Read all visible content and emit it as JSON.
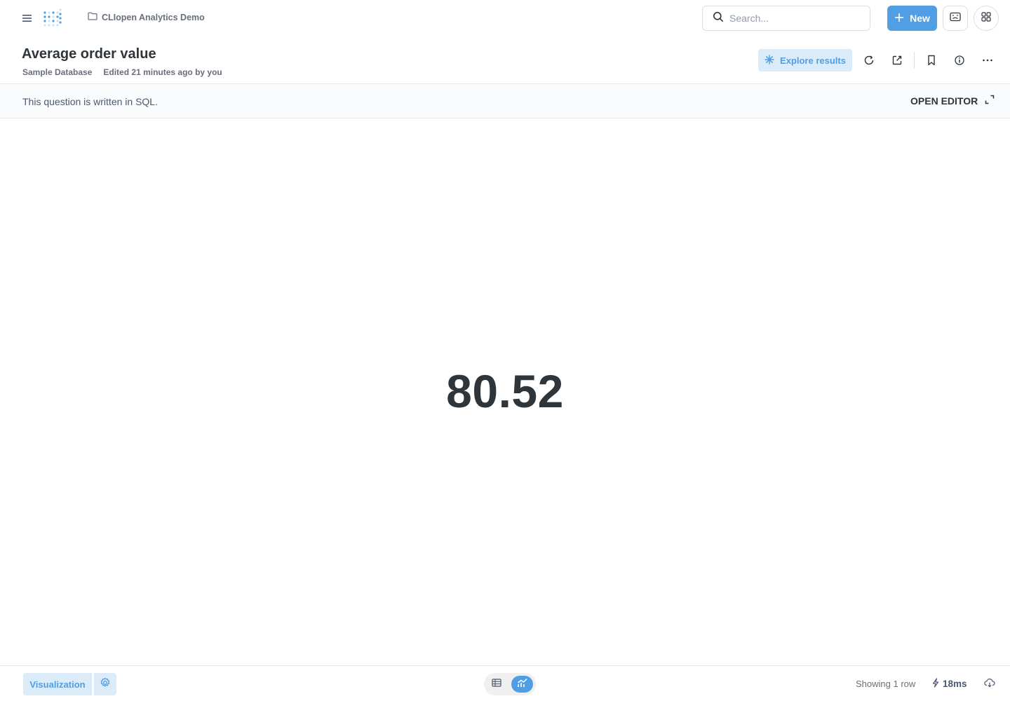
{
  "nav": {
    "breadcrumb_label": "CLIopen Analytics Demo",
    "search_placeholder": "Search...",
    "new_label": "New"
  },
  "question": {
    "title": "Average order value",
    "database": "Sample Database",
    "edited": "Edited 21 minutes ago by you",
    "explore_label": "Explore results"
  },
  "sql_banner": {
    "text": "This question is written in SQL.",
    "open_editor_label": "OPEN EDITOR"
  },
  "result": {
    "value": "80.52"
  },
  "footer": {
    "visualization_label": "Visualization",
    "row_count": "Showing 1 row",
    "timing": "18ms"
  },
  "colors": {
    "brand": "#509ee3",
    "brand_light": "#dcebf8",
    "text_dark": "#2e353b",
    "text_medium": "#696e7b",
    "border": "#dcdfe0"
  },
  "icons": [
    "hamburger-icon",
    "metabase-logo",
    "folder-icon",
    "search-icon",
    "plus-icon",
    "keyboard-icon",
    "grid-icon",
    "sparkle-icon",
    "refresh-icon",
    "share-icon",
    "bookmark-icon",
    "info-icon",
    "more-icon",
    "expand-icon",
    "gear-icon",
    "table-icon",
    "chart-icon",
    "bolt-icon",
    "download-icon"
  ]
}
